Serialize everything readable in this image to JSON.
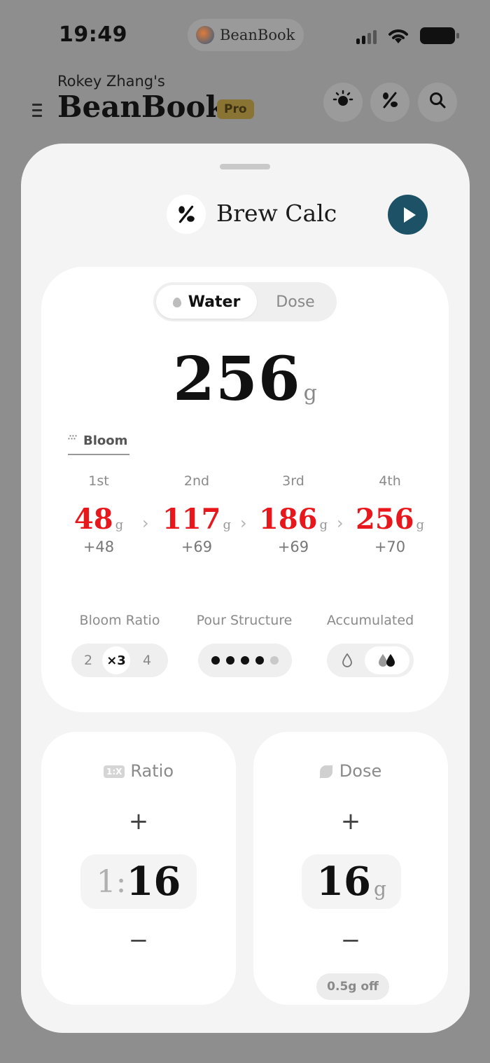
{
  "status_bar": {
    "time": "19:49",
    "island_app": "BeanBook",
    "icons": [
      "signal-icon",
      "wifi-icon",
      "battery-icon"
    ]
  },
  "header": {
    "owner": "Rokey Zhang's",
    "brand": "BeanBook",
    "badge": "Pro",
    "icons": [
      "roast-icon",
      "ratio-icon",
      "search-icon"
    ]
  },
  "sheet": {
    "title": "Brew Calc",
    "mode_tabs": [
      {
        "label": "Water",
        "selected": true
      },
      {
        "label": "Dose",
        "selected": false
      }
    ],
    "water_value": "256",
    "water_unit": "g",
    "bloom_tab": "Bloom",
    "pours": [
      {
        "label": "1st",
        "value": "48",
        "unit": "g",
        "increment": "+48"
      },
      {
        "label": "2nd",
        "value": "117",
        "unit": "g",
        "increment": "+69"
      },
      {
        "label": "3rd",
        "value": "186",
        "unit": "g",
        "increment": "+69"
      },
      {
        "label": "4th",
        "value": "256",
        "unit": "g",
        "increment": "+70"
      }
    ],
    "options": {
      "bloom_ratio": {
        "label": "Bloom Ratio",
        "values": [
          "2",
          "×3",
          "4"
        ],
        "selected": "×3"
      },
      "pour_structure": {
        "label": "Pour Structure",
        "filled": 4,
        "total": 5
      },
      "accumulated": {
        "label": "Accumulated",
        "selected": "accumulated"
      }
    },
    "ratio_card": {
      "tag": "1:X",
      "title": "Ratio",
      "prefix": "1:",
      "value": "16"
    },
    "dose_card": {
      "title": "Dose",
      "value": "16",
      "unit": "g",
      "badge": "0.5g off"
    },
    "colors": {
      "accent_play": "#1c5166",
      "pour_value": "#e8171c",
      "pro_badge": "#8a7433"
    }
  }
}
